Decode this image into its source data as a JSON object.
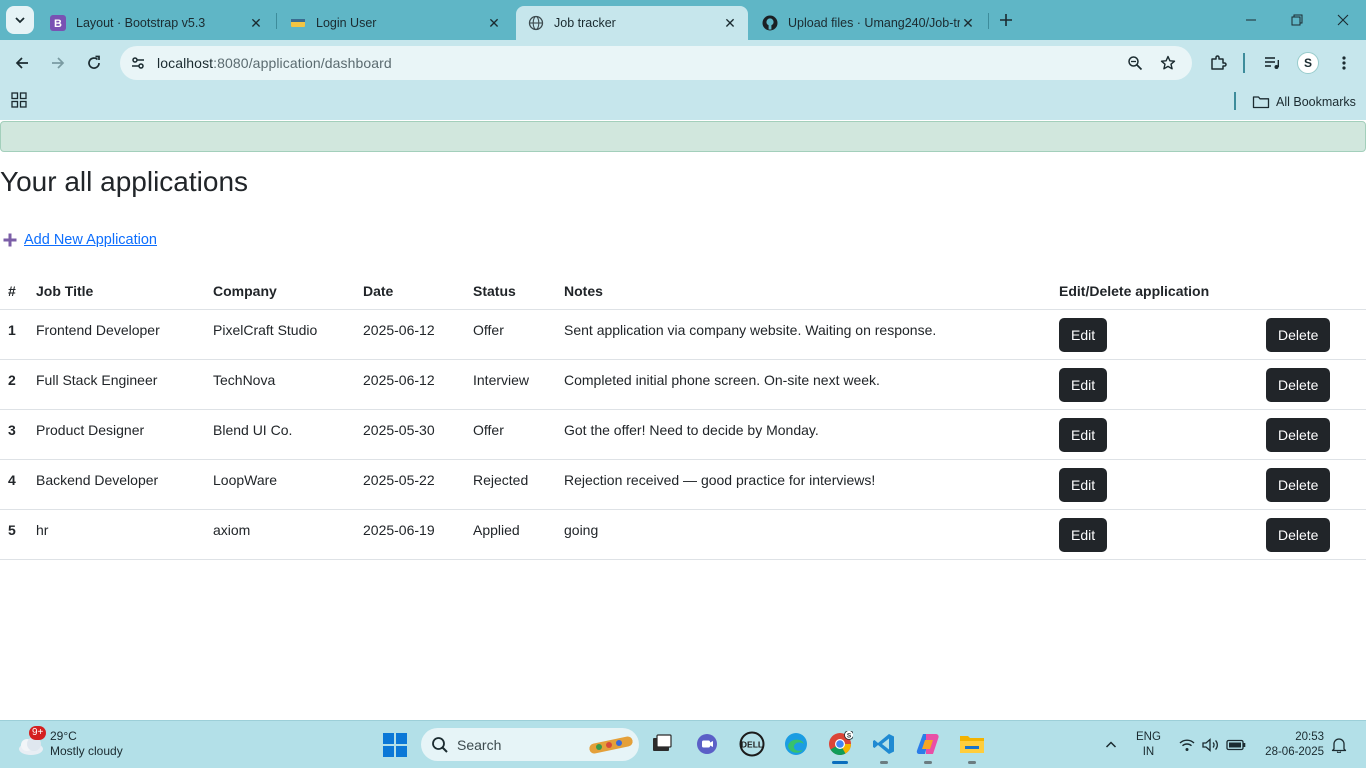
{
  "browser": {
    "tabs": [
      {
        "title": "Layout · Bootstrap v5.3",
        "favicon": "bootstrap-icon",
        "active": false
      },
      {
        "title": "Login User",
        "favicon": "page-icon",
        "active": false
      },
      {
        "title": "Job tracker",
        "favicon": "globe-icon",
        "active": true
      },
      {
        "title": "Upload files · Umang240/Job-tr",
        "favicon": "github-icon",
        "active": false
      }
    ],
    "url_host": "localhost",
    "url_path": ":8080/application/dashboard",
    "profile_initial": "S",
    "bookmarks_label": "All Bookmarks"
  },
  "page": {
    "title": "Your all applications",
    "add_link": "Add New Application",
    "columns": [
      "#",
      "Job Title",
      "Company",
      "Date",
      "Status",
      "Notes",
      "Edit/Delete application"
    ],
    "rows": [
      {
        "num": "1",
        "job_title": "Frontend Developer",
        "company": "PixelCraft Studio",
        "date": "2025-06-12",
        "status": "Offer",
        "notes": "Sent application via company website. Waiting on response."
      },
      {
        "num": "2",
        "job_title": "Full Stack Engineer",
        "company": "TechNova",
        "date": "2025-06-12",
        "status": "Interview",
        "notes": "Completed initial phone screen. On-site next week."
      },
      {
        "num": "3",
        "job_title": "Product Designer",
        "company": "Blend UI Co.",
        "date": "2025-05-30",
        "status": "Offer",
        "notes": "Got the offer! Need to decide by Monday."
      },
      {
        "num": "4",
        "job_title": "Backend Developer",
        "company": "LoopWare",
        "date": "2025-05-22",
        "status": "Rejected",
        "notes": "Rejection received — good practice for interviews!"
      },
      {
        "num": "5",
        "job_title": "hr",
        "company": "axiom",
        "date": "2025-06-19",
        "status": "Applied",
        "notes": "going"
      }
    ],
    "edit_label": "Edit",
    "delete_label": "Delete"
  },
  "taskbar": {
    "weather_badge": "9+",
    "temperature": "29°C",
    "condition": "Mostly cloudy",
    "search_label": "Search",
    "lang_line1": "ENG",
    "lang_line2": "IN",
    "time": "20:53",
    "date": "28-06-2025"
  },
  "colors": {
    "tabstrip": "#5fb6c6",
    "toolbar": "#c6e6ec",
    "alert": "#d1e7dd",
    "link": "#0d6efd",
    "button_dark": "#212529"
  }
}
